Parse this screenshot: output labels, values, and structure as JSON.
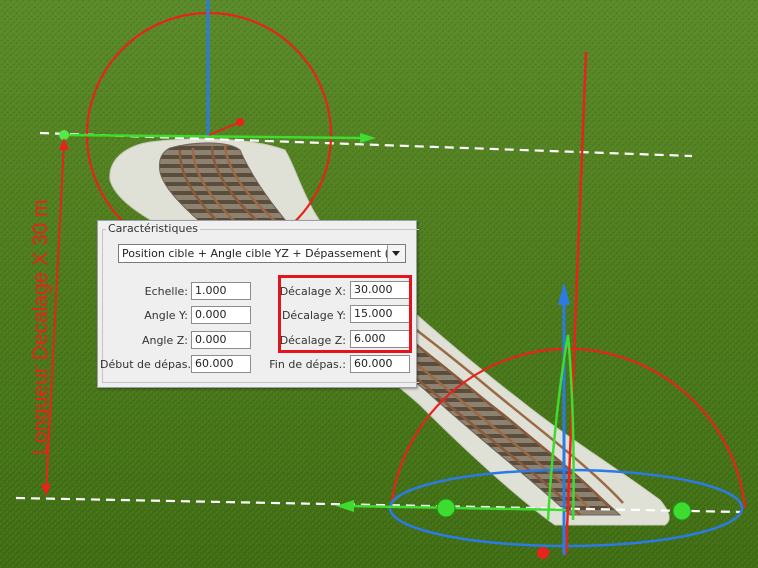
{
  "annotation": {
    "vertical_label": "Longueur Decalage X 30 m"
  },
  "panel": {
    "group_title": "Caractéristiques",
    "mode": {
      "selected": "Position cible + Angle cible YZ + Dépassement (m)"
    },
    "left_fields": [
      {
        "label": "Echelle:",
        "value": "1.000"
      },
      {
        "label": "Angle Y:",
        "value": "0.000"
      },
      {
        "label": "Angle Z:",
        "value": "0.000"
      },
      {
        "label": "Début de dépas.:",
        "value": "60.000"
      }
    ],
    "right_fields": [
      {
        "label": "Décalage X:",
        "value": "30.000"
      },
      {
        "label": "Décalage Y:",
        "value": "15.000"
      },
      {
        "label": "Décalage Z:",
        "value": "6.000"
      },
      {
        "label": "Fin de dépas.:",
        "value": "60.000"
      }
    ]
  },
  "colors": {
    "grass": "#4f7d1e",
    "annotation_red": "#e8221c",
    "gizmo_blue": "#2c7be5",
    "gizmo_green": "#3ddc2e",
    "highlight": "#e3141b"
  }
}
